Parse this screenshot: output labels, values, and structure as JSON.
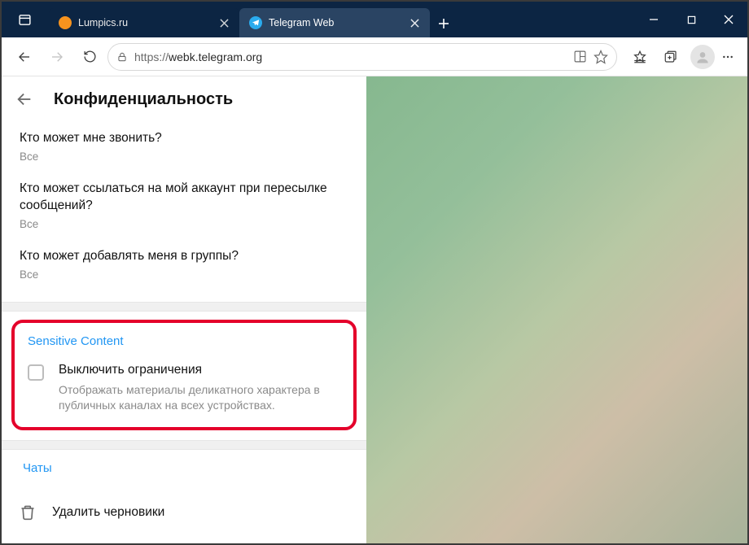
{
  "window": {
    "tabs": [
      {
        "label": "Lumpics.ru",
        "favicon_color": "#f7931e"
      },
      {
        "label": "Telegram Web",
        "favicon_color": "#2AABEE"
      }
    ]
  },
  "toolbar": {
    "url_scheme": "https://",
    "url_host": "webk.telegram.org",
    "url_path": ""
  },
  "page": {
    "title": "Конфиденциальность",
    "options": [
      {
        "question": "Кто может мне звонить?",
        "value": "Все"
      },
      {
        "question": "Кто может ссылаться на мой аккаунт при пересылке сообщений?",
        "value": "Все"
      },
      {
        "question": "Кто может добавлять меня в группы?",
        "value": "Все"
      }
    ],
    "sensitive": {
      "section_title": "Sensitive Content",
      "option_label": "Выключить ограничения",
      "option_desc": "Отображать материалы деликатного характера в публичных каналах на всех устройствах."
    },
    "chats": {
      "section_title": "Чаты",
      "delete_drafts": "Удалить черновики"
    }
  }
}
